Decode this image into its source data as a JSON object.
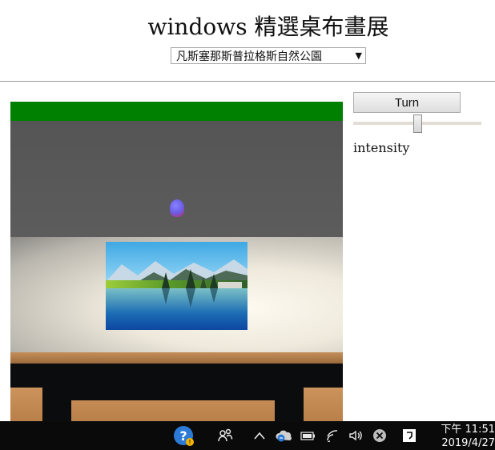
{
  "page": {
    "title": "windows 精選桌布畫展",
    "select_value": "凡斯塞那斯普拉格斯自然公園"
  },
  "controls": {
    "turn_label": "Turn",
    "intensity_label": "intensity",
    "intensity_level": 0.5
  },
  "scene": {
    "colors": {
      "banner": "#008000",
      "ceiling": "#5a5a5a",
      "table": "#0b0c0d",
      "light_orb": "#6a5fe8"
    }
  },
  "taskbar": {
    "time": "下午 11:51",
    "date": "2019/4/27",
    "icons": [
      "help-icon",
      "people-icon",
      "chevron-up-icon",
      "onedrive-sync-icon",
      "battery-icon",
      "wifi-icon",
      "speaker-icon",
      "close-circle-icon",
      "action-center-icon"
    ]
  }
}
